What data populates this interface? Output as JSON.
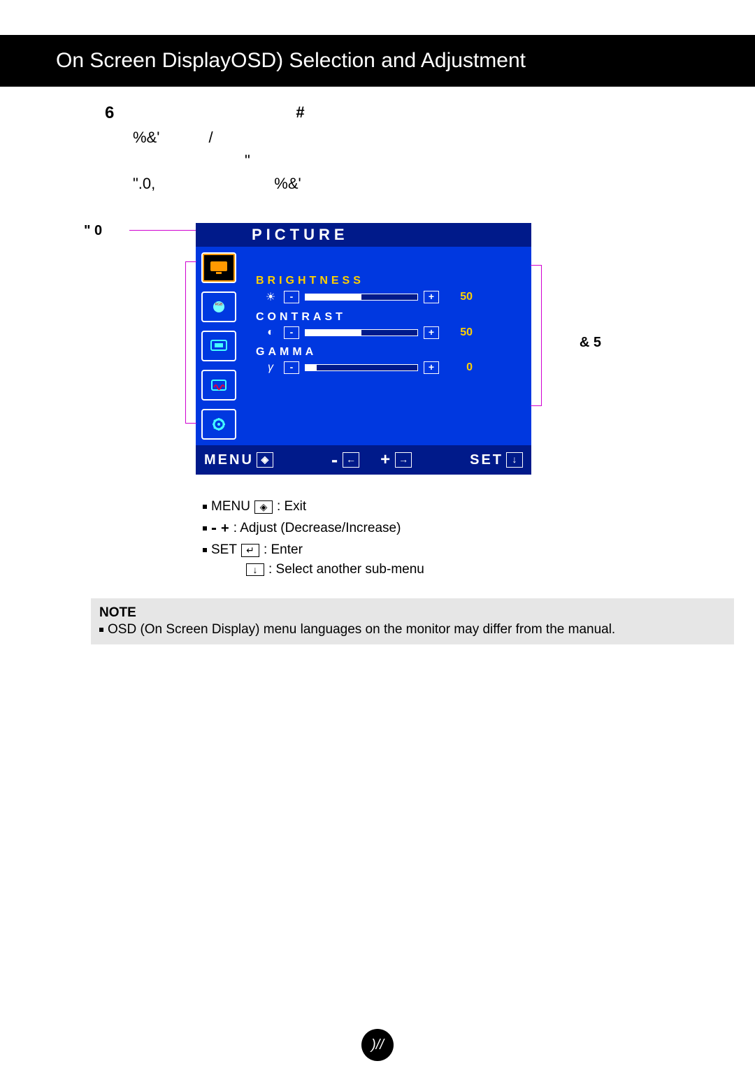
{
  "header": {
    "title": "On Screen DisplayOSD) Selection and Adjustment"
  },
  "instructions": {
    "l1": "6",
    "l1b": "#",
    "l2a": "%&'",
    "l2b": "/",
    "l3": "\"",
    "l4a": "\".0,",
    "l4b": "%&'",
    "l5": "\"  0"
  },
  "labels": {
    "submenu": "& 5"
  },
  "osd": {
    "title": "PICTURE",
    "items": [
      {
        "label": "BRIGHTNESS",
        "value": "50",
        "fill": 50,
        "selected": true
      },
      {
        "label": "CONTRAST",
        "value": "50",
        "fill": 50,
        "selected": false
      },
      {
        "label": "GAMMA",
        "value": "0",
        "fill": 10,
        "selected": false
      }
    ],
    "footer": {
      "menu": "MENU",
      "minus": "-",
      "plus": "+",
      "set": "SET"
    }
  },
  "legend": {
    "menu_label": "MENU",
    "menu_desc": ": Exit",
    "adjust_desc": ": Adjust (Decrease/Increase)",
    "set_label": "SET",
    "set_desc": ": Enter",
    "down_desc": ": Select another sub-menu"
  },
  "note": {
    "title": "NOTE",
    "body": "OSD (On Screen Display) menu languages on the monitor may differ from the manual."
  },
  "page": ")//"
}
